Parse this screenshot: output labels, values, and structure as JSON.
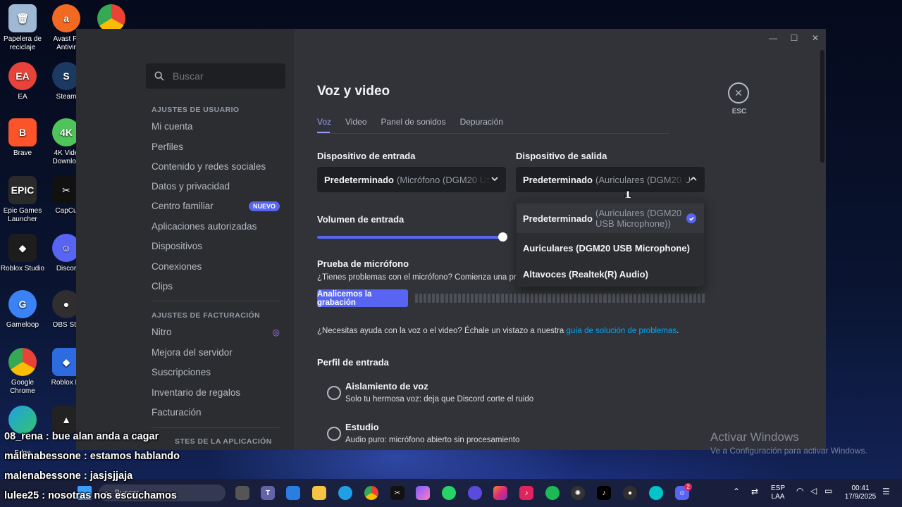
{
  "desktop": {
    "icons": [
      {
        "label": "Papelera de reciclaje",
        "icon": "recycle-bin-icon"
      },
      {
        "label": "Avast Fr Antivir",
        "icon": "avast-icon"
      },
      {
        "label": "EA",
        "icon": "ea-icon"
      },
      {
        "label": "Steam",
        "icon": "steam-icon"
      },
      {
        "label": "Brave",
        "icon": "brave-icon"
      },
      {
        "label": "4K Vide Downloa",
        "icon": "4k-video-downloader-icon"
      },
      {
        "label": "Epic Games Launcher",
        "icon": "epic-games-icon"
      },
      {
        "label": "CapCu",
        "icon": "capcut-icon"
      },
      {
        "label": "Roblox Studio",
        "icon": "roblox-studio-icon"
      },
      {
        "label": "Discor",
        "icon": "discord-icon"
      },
      {
        "label": "Gameloop",
        "icon": "gameloop-icon"
      },
      {
        "label": "OBS Stu",
        "icon": "obs-icon"
      },
      {
        "label": "Google Chrome",
        "icon": "chrome-icon"
      },
      {
        "label": "Roblox Pl",
        "icon": "roblox-player-icon"
      },
      {
        "label": "Edge",
        "icon": "edge-icon"
      }
    ]
  },
  "sidebar": {
    "search_placeholder": "Buscar",
    "user_settings_header": "AJUSTES DE USUARIO",
    "user_items": [
      "Mi cuenta",
      "Perfiles",
      "Contenido y redes sociales",
      "Datos y privacidad",
      "Centro familiar",
      "Aplicaciones autorizadas",
      "Dispositivos",
      "Conexiones",
      "Clips"
    ],
    "new_badge": "NUEVO",
    "billing_header": "AJUSTES DE FACTURACIÓN",
    "billing_items": [
      "Nitro",
      "Mejora del servidor",
      "Suscripciones",
      "Inventario de regalos",
      "Facturación"
    ],
    "app_header_partial": "STES DE LA APLICACIÓN"
  },
  "main": {
    "title": "Voz y video",
    "tabs": [
      "Voz",
      "Video",
      "Panel de sonidos",
      "Depuración"
    ],
    "esc_label": "ESC",
    "input_device_label": "Dispositivo de entrada",
    "input_device_main": "Predeterminado",
    "input_device_detail": "(Micrófono (DGM20 U:",
    "output_device_label": "Dispositivo de salida",
    "output_device_main": "Predeterminado",
    "output_device_detail": "(Auriculares (DGM20 U",
    "output_options": [
      {
        "main": "Predeterminado",
        "detail": "(Auriculares (DGM20 USB Microphone))",
        "selected": true
      },
      {
        "main": "Auriculares (DGM20 USB Microphone)",
        "detail": "",
        "selected": false
      },
      {
        "main": "Altavoces (Realtek(R) Audio)",
        "detail": "",
        "selected": false
      }
    ],
    "input_volume_label": "Volumen de entrada",
    "input_volume_level": 1.0,
    "mic_test_label": "Prueba de micrófono",
    "mic_test_desc": "¿Tienes problemas con el micrófono? Comienza una prueb",
    "mic_test_button": "Analicemos la grabación",
    "help_text": "¿Necesitas ayuda con la voz o el video? Échale un vistazo a nuestra ",
    "help_link": "guía de solución de problemas",
    "help_end": ".",
    "input_profile_label": "Perfil de entrada",
    "profiles": [
      {
        "title": "Aislamiento de voz",
        "desc": "Solo tu hermosa voz: deja que Discord corte el ruido"
      },
      {
        "title": "Estudio",
        "desc": "Audio puro: micrófono abierto sin procesamiento"
      }
    ]
  },
  "watermark": {
    "line1": "Activar Windows",
    "line2": "Ve a Configuración para activar Windows."
  },
  "chat": [
    {
      "user": "08_rena",
      "msg": "bue alan anda a cagar"
    },
    {
      "user": "malenabessone",
      "msg": "estamos hablando"
    },
    {
      "user": "malenabessone",
      "msg": "jasjsjjaja"
    },
    {
      "user": "lulee25",
      "msg": "nosotras nos escuchamos"
    }
  ],
  "taskbar": {
    "search_placeholder": "Buscar",
    "lang_1": "ESP",
    "lang_2": "LAA",
    "time": "00:41",
    "date": "17/9/2025",
    "discord_badge": "2"
  }
}
